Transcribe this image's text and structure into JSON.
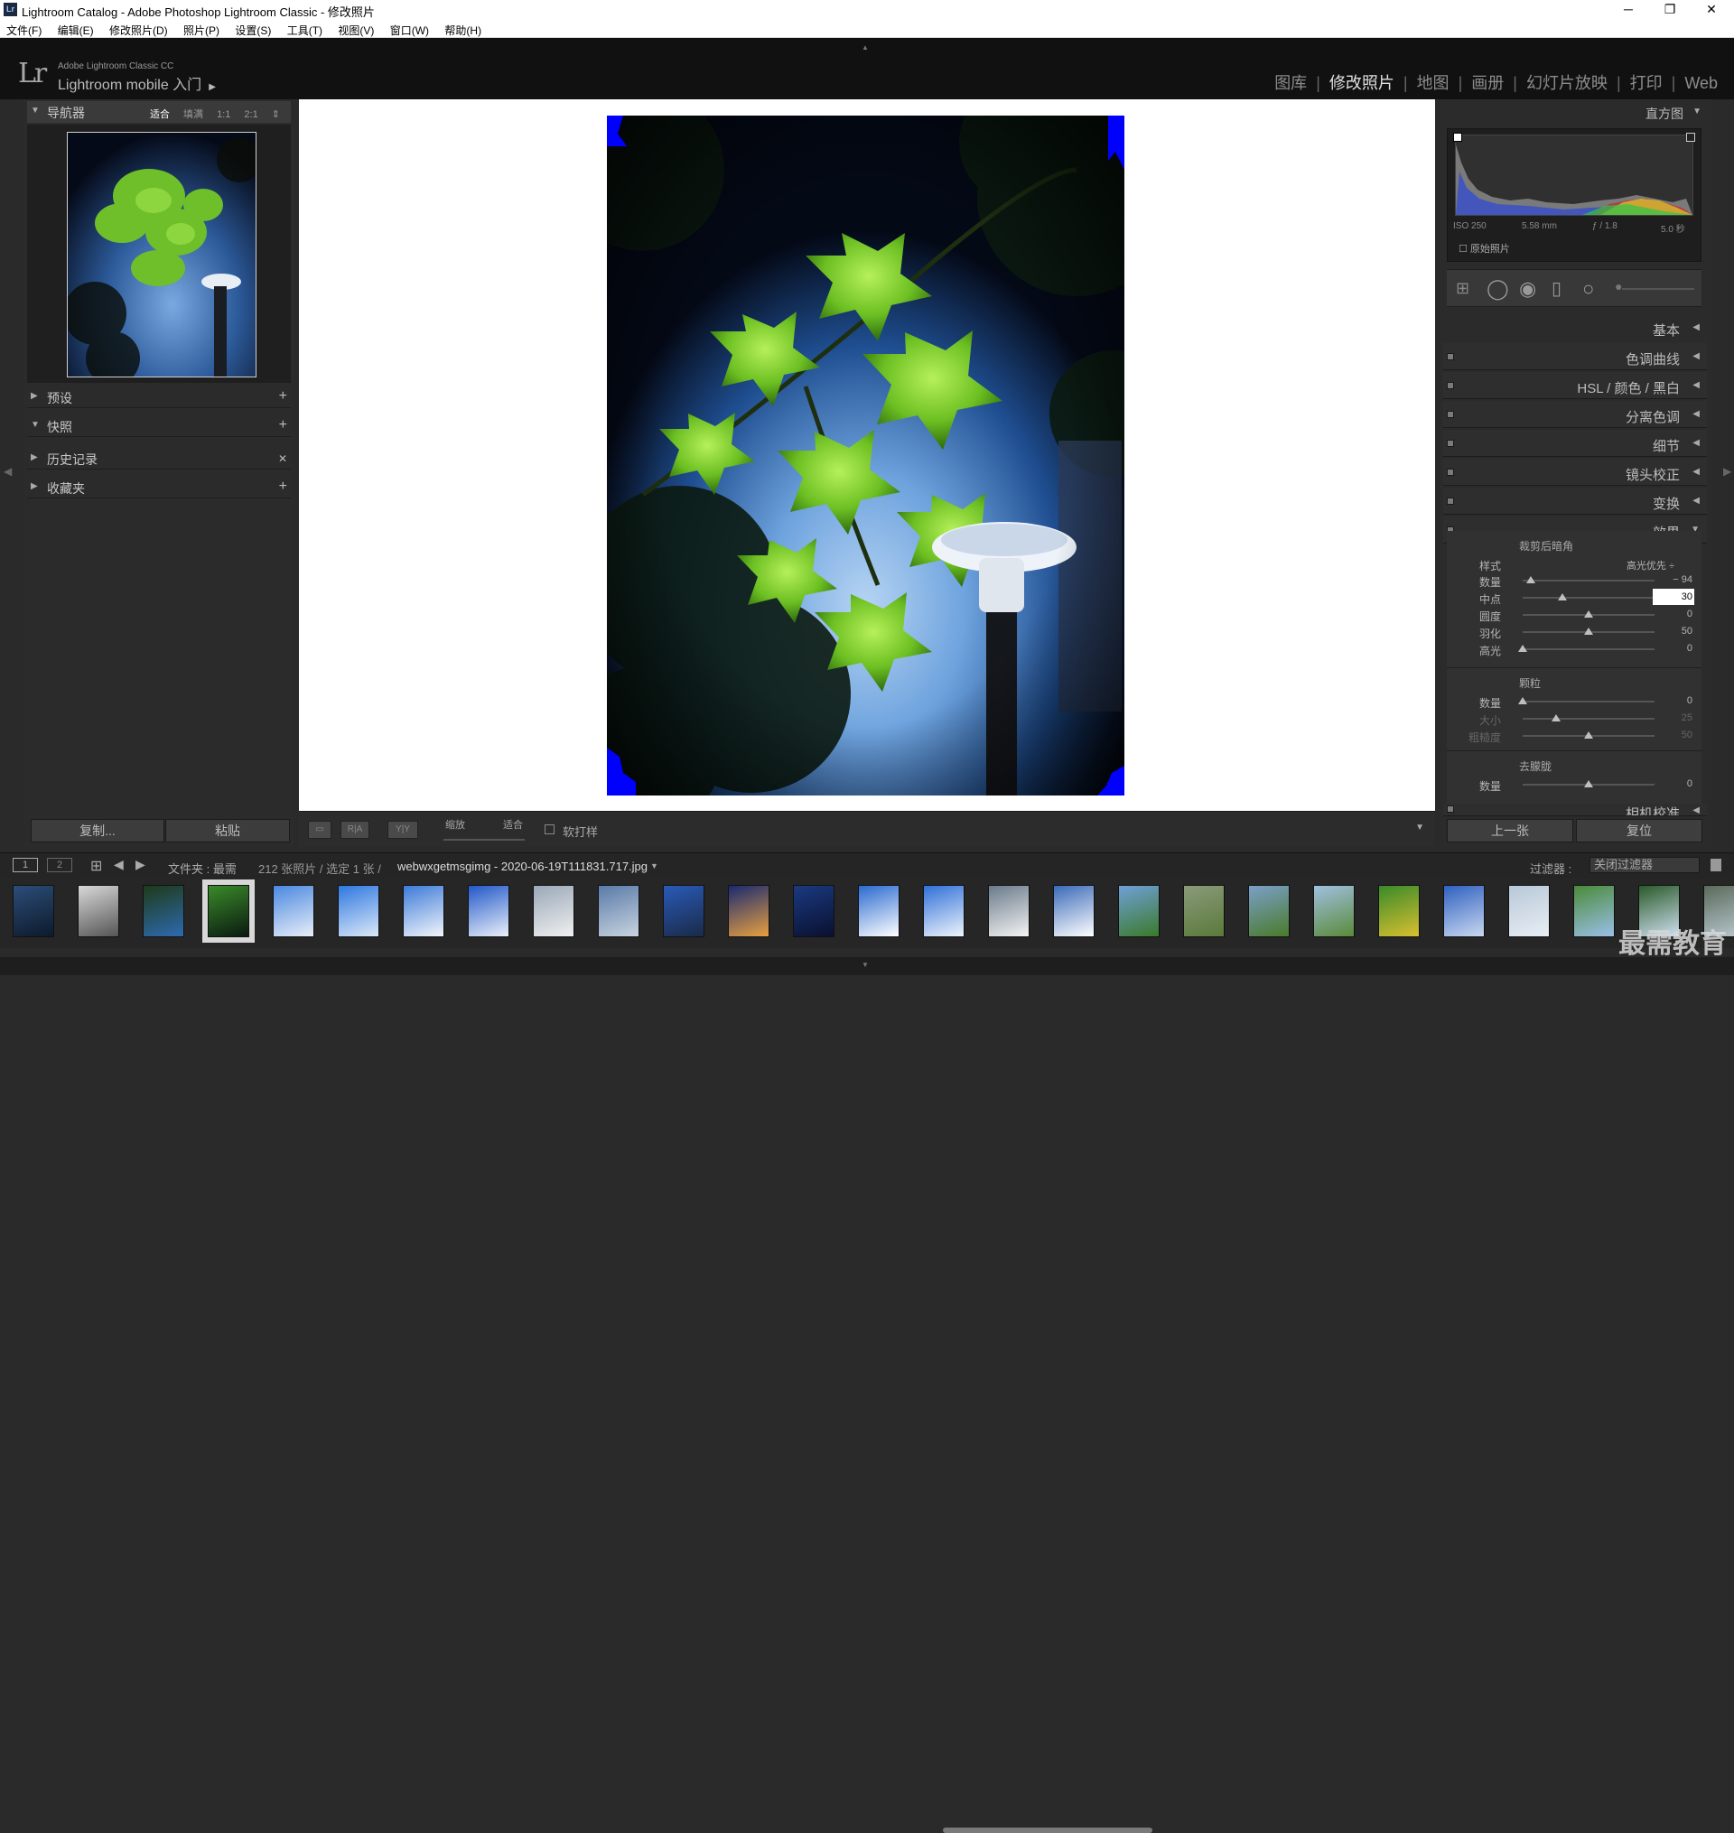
{
  "window": {
    "title": "Lightroom Catalog - Adobe Photoshop Lightroom Classic - 修改照片",
    "app_badge": "Lr",
    "minimize": "─",
    "maximize": "❐",
    "close": "✕"
  },
  "menu": [
    "文件(F)",
    "编辑(E)",
    "修改照片(D)",
    "照片(P)",
    "设置(S)",
    "工具(T)",
    "视图(V)",
    "窗口(W)",
    "帮助(H)"
  ],
  "identity": {
    "logo": "Lr",
    "product": "Adobe Lightroom Classic CC",
    "mobile": "Lightroom mobile 入门",
    "mobile_arrow": "▶"
  },
  "modules": [
    "图库",
    "修改照片",
    "地图",
    "画册",
    "幻灯片放映",
    "打印",
    "Web"
  ],
  "active_module": "修改照片",
  "left_panel": {
    "navigator": {
      "title": "导航器",
      "options": [
        "适合",
        "填满",
        "1:1",
        "2:1"
      ],
      "selected_option": "适合"
    },
    "sections": [
      {
        "label": "预设",
        "action": "+"
      },
      {
        "label": "快照",
        "action": "+"
      },
      {
        "label": "历史记录",
        "action": "✕"
      },
      {
        "label": "收藏夹",
        "action": "+"
      }
    ],
    "copy_label": "复制...",
    "paste_label": "粘贴"
  },
  "toolbar": {
    "view_loupe": "",
    "view_ra": "R|A",
    "view_yy": "Y|Y",
    "zoom_label": "缩放",
    "zoom_value": "适合",
    "softproof_label": "软打样"
  },
  "right_panel": {
    "histogram_title": "直方图",
    "hist_stats": {
      "iso": "ISO 250",
      "focal": "5.58 mm",
      "aperture": "ƒ / 1.8",
      "shutter": "5.0 秒"
    },
    "original_photo": "原始照片",
    "sections": [
      {
        "label": "基本",
        "open": false
      },
      {
        "label": "色调曲线",
        "open": false
      },
      {
        "label": "HSL / 颜色 / 黑白",
        "open": false
      },
      {
        "label": "分离色调",
        "open": false
      },
      {
        "label": "细节",
        "open": false
      },
      {
        "label": "镜头校正",
        "open": false
      },
      {
        "label": "变换",
        "open": false
      },
      {
        "label": "效果",
        "open": true
      }
    ],
    "effects": {
      "vignette_title": "裁剪后暗角",
      "style_label": "样式",
      "style_value": "高光优先 ÷",
      "vignette_sliders": [
        {
          "label": "数量",
          "value": "− 94",
          "pos": 0.06
        },
        {
          "label": "中点",
          "value": "30",
          "pos": 0.3,
          "editing": true
        },
        {
          "label": "圆度",
          "value": "0",
          "pos": 0.5
        },
        {
          "label": "羽化",
          "value": "50",
          "pos": 0.5
        },
        {
          "label": "高光",
          "value": "0",
          "pos": 0.0
        }
      ],
      "grain_title": "颗粒",
      "grain_sliders": [
        {
          "label": "数量",
          "value": "0",
          "pos": 0.0
        },
        {
          "label": "大小",
          "value": "25",
          "pos": 0.25,
          "dim": true
        },
        {
          "label": "粗糙度",
          "value": "50",
          "pos": 0.5,
          "dim": true
        }
      ],
      "dehaze_title": "去朦胧",
      "dehaze_sliders": [
        {
          "label": "数量",
          "value": "0",
          "pos": 0.5
        }
      ]
    },
    "camera_calibration": "相机校准",
    "prev_label": "上一张",
    "reset_label": "复位"
  },
  "filmstrip_bar": {
    "screen1": "1",
    "screen2": "2",
    "source": "文件夹 : 最需",
    "count": "212 张照片 / 选定 1 张 /",
    "filename": "webwxgetmsgimg - 2020-06-19T111831.717.jpg",
    "filter_label": "过滤器 :",
    "filter_value": "关闭过滤器"
  },
  "filmstrip_selected_index": 3,
  "watermark": "最需教育",
  "colors": {
    "accent_white": "#ffffff",
    "panel_bg": "#2b2b2b",
    "clip_blue": "#0000ff"
  }
}
